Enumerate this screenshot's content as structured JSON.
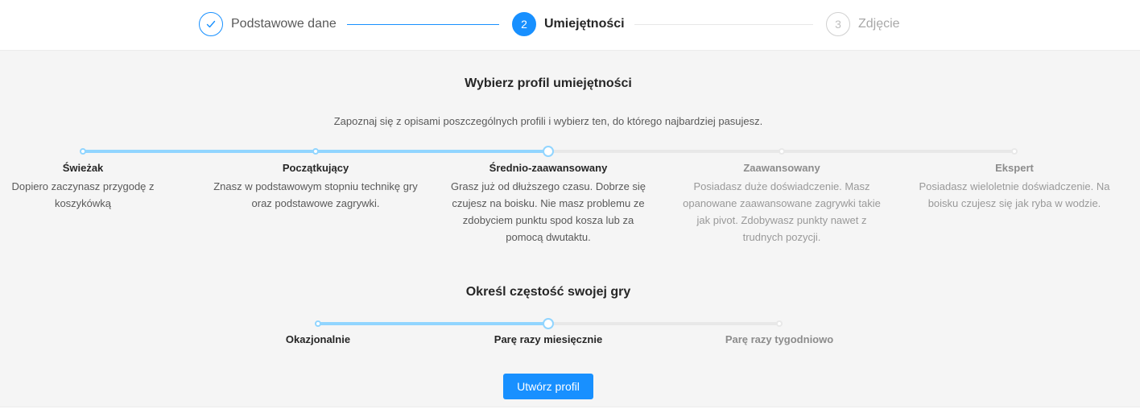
{
  "steps": [
    {
      "number": "1",
      "title": "Podstawowe dane",
      "status": "done",
      "icon": "check-icon"
    },
    {
      "number": "2",
      "title": "Umiejętności",
      "status": "active"
    },
    {
      "number": "3",
      "title": "Zdjęcie",
      "status": "wait"
    }
  ],
  "skills": {
    "heading": "Wybierz profil umiejętności",
    "subtitle": "Zapoznaj się z opisami poszczególnych profili i wybierz ten, do którego najbardziej pasujesz.",
    "selected_index": 2,
    "levels": [
      {
        "title": "Świeżak",
        "description": "Dopiero zaczynasz przygodę z koszykówką"
      },
      {
        "title": "Początkujący",
        "description": "Znasz w podstawowym stopniu technikę gry oraz podstawowe zagrywki."
      },
      {
        "title": "Średnio-zaawansowany",
        "description": "Grasz już od dłuższego czasu. Dobrze się czujesz na boisku. Nie masz problemu ze zdobyciem punktu spod kosza lub za pomocą dwutaktu."
      },
      {
        "title": "Zaawansowany",
        "description": "Posiadasz duże doświadczenie. Masz opanowane zaawansowane zagrywki takie jak pivot. Zdobywasz punkty nawet z trudnych pozycji."
      },
      {
        "title": "Ekspert",
        "description": "Posiadasz wieloletnie doświadczenie. Na boisku czujesz się jak ryba w wodzie."
      }
    ]
  },
  "frequency": {
    "heading": "Określ częstość swojej gry",
    "selected_index": 1,
    "options": [
      "Okazjonalnie",
      "Parę razy miesięcznie",
      "Parę razy tygodniowo"
    ]
  },
  "submit_label": "Utwórz profil",
  "colors": {
    "primary": "#1890ff",
    "slider_fill": "#91d5ff",
    "slider_track": "#e8e8e8",
    "content_bg": "#f5f5f5"
  }
}
